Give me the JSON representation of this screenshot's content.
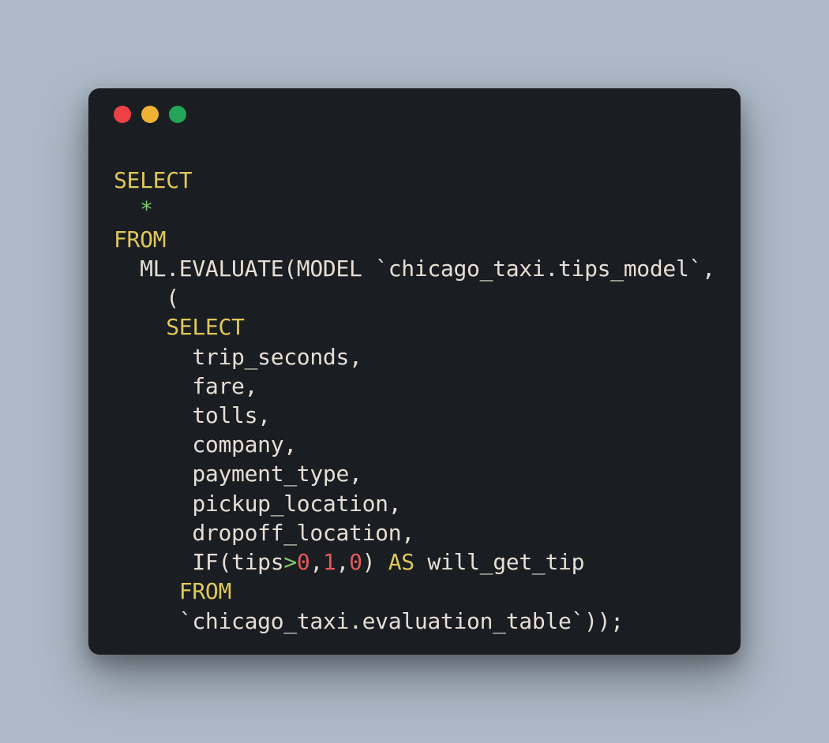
{
  "window": {
    "dots": [
      "red",
      "yellow",
      "green"
    ]
  },
  "code": {
    "tokens": [
      {
        "type": "kw",
        "text": "SELECT"
      },
      {
        "type": "nl"
      },
      {
        "type": "plain",
        "text": "  "
      },
      {
        "type": "star",
        "text": "*"
      },
      {
        "type": "nl"
      },
      {
        "type": "kw",
        "text": "FROM"
      },
      {
        "type": "nl"
      },
      {
        "type": "plain",
        "text": "  ML.EVALUATE(MODEL `chicago_taxi.tips_model`,"
      },
      {
        "type": "nl"
      },
      {
        "type": "plain",
        "text": "    ("
      },
      {
        "type": "nl"
      },
      {
        "type": "plain",
        "text": "    "
      },
      {
        "type": "kw",
        "text": "SELECT"
      },
      {
        "type": "nl"
      },
      {
        "type": "plain",
        "text": "      trip_seconds,"
      },
      {
        "type": "nl"
      },
      {
        "type": "plain",
        "text": "      fare,"
      },
      {
        "type": "nl"
      },
      {
        "type": "plain",
        "text": "      tolls,"
      },
      {
        "type": "nl"
      },
      {
        "type": "plain",
        "text": "      company,"
      },
      {
        "type": "nl"
      },
      {
        "type": "plain",
        "text": "      payment_type,"
      },
      {
        "type": "nl"
      },
      {
        "type": "plain",
        "text": "      pickup_location,"
      },
      {
        "type": "nl"
      },
      {
        "type": "plain",
        "text": "      dropoff_location,"
      },
      {
        "type": "nl"
      },
      {
        "type": "plain",
        "text": "      IF(tips"
      },
      {
        "type": "gt",
        "text": ">"
      },
      {
        "type": "num",
        "text": "0"
      },
      {
        "type": "plain",
        "text": ","
      },
      {
        "type": "num",
        "text": "1"
      },
      {
        "type": "plain",
        "text": ","
      },
      {
        "type": "num",
        "text": "0"
      },
      {
        "type": "plain",
        "text": ") "
      },
      {
        "type": "kw",
        "text": "AS"
      },
      {
        "type": "plain",
        "text": " will_get_tip"
      },
      {
        "type": "nl"
      },
      {
        "type": "plain",
        "text": "     "
      },
      {
        "type": "kw",
        "text": "FROM"
      },
      {
        "type": "nl"
      },
      {
        "type": "plain",
        "text": "     `chicago_taxi.evaluation_table`));"
      }
    ]
  }
}
